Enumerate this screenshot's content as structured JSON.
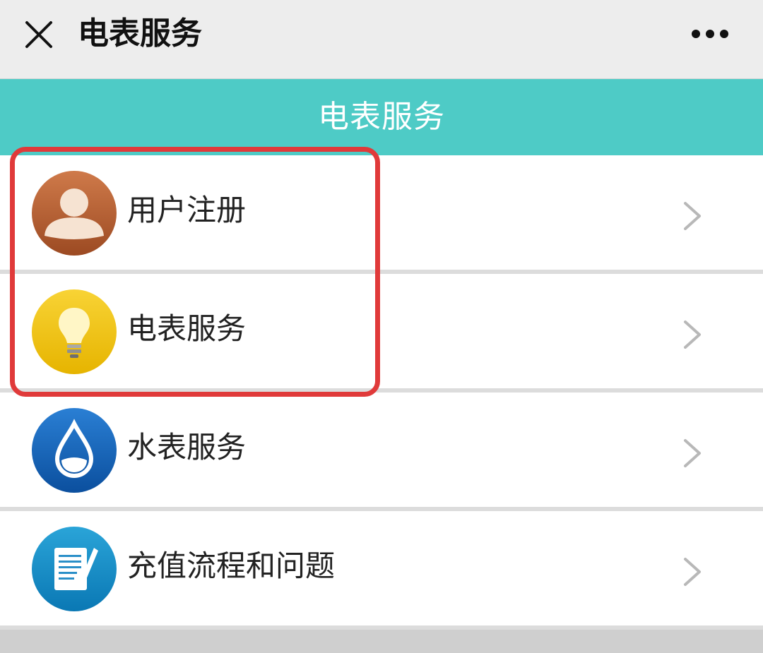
{
  "topbar": {
    "title": "电表服务",
    "close_icon": "close-icon",
    "more_icon": "more-icon"
  },
  "banner": {
    "title": "电表服务",
    "color": "#4ecbc6"
  },
  "menu": {
    "items": [
      {
        "label": "用户注册",
        "icon": "user-icon"
      },
      {
        "label": "电表服务",
        "icon": "lightbulb-icon"
      },
      {
        "label": "水表服务",
        "icon": "water-drop-icon"
      },
      {
        "label": "充值流程和问题",
        "icon": "document-icon"
      }
    ]
  },
  "highlight": {
    "color": "#e03a3a"
  }
}
